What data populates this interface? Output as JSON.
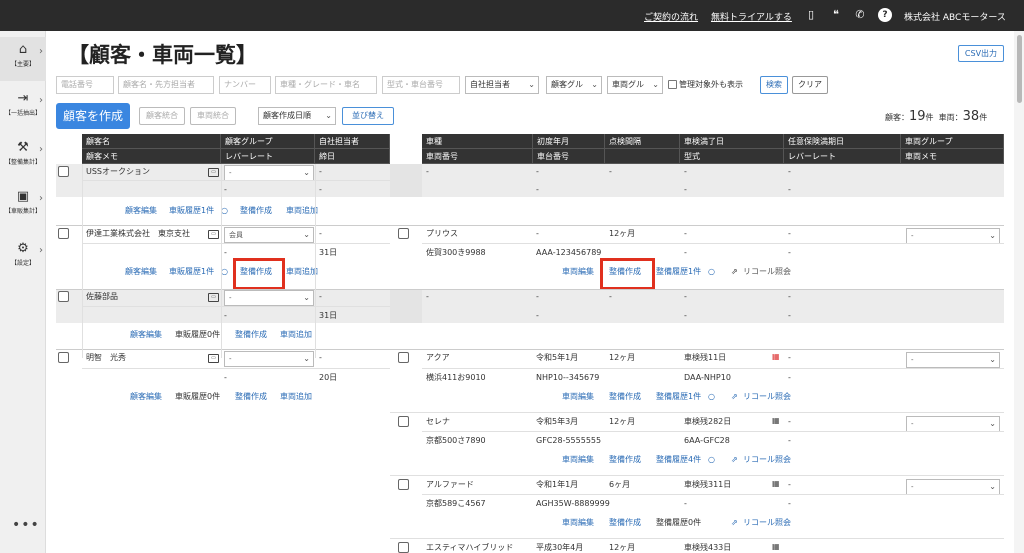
{
  "topbar": {
    "links": [
      "ご契約の流れ",
      "無料トライアルする"
    ],
    "company": "株式会社 ABCモータース",
    "icons": [
      "document-icon",
      "chat-icon",
      "phone-icon",
      "help-icon"
    ]
  },
  "sidebar": {
    "items": [
      {
        "label": "【主要】",
        "icon": "home-icon",
        "glyph": "⌂"
      },
      {
        "label": "【一括抽出】",
        "icon": "extract-icon",
        "glyph": "⇥"
      },
      {
        "label": "【整備集計】",
        "icon": "wrench-icon",
        "glyph": "⚒"
      },
      {
        "label": "【車販集計】",
        "icon": "car-icon",
        "glyph": "▣"
      },
      {
        "label": "【設定】",
        "icon": "gear-icon",
        "glyph": "⚙"
      }
    ],
    "more": "•••"
  },
  "page": {
    "title": "【顧客・車両一覧】",
    "csv_button": "CSV出力"
  },
  "filters": {
    "phone_placeholder": "電話番号",
    "name_placeholder": "顧客名・先方担当者",
    "number_placeholder": "ナンバー",
    "model_placeholder": "車種・グレード・車名",
    "type_placeholder": "型式・車台番号",
    "staff_select": "自社担当者",
    "customer_group_select": "顧客グル",
    "vehicle_group_select": "車両グル",
    "include_unmanaged": "管理対象外も表示",
    "search": "検索",
    "clear": "クリア"
  },
  "actions": {
    "create_customer": "顧客を作成",
    "merge_customers": "顧客統合",
    "merge_vehicles": "車両統合",
    "sort_select": "顧客作成日順",
    "sort_button": "並び替え"
  },
  "counts": {
    "customers_label": "顧客：",
    "customers_value": "19",
    "vehicles_label": "車両：",
    "vehicles_value": "38",
    "unit": "件"
  },
  "customer_headers": {
    "row1": [
      "顧客名",
      "顧客グループ",
      "自社担当者"
    ],
    "row2": [
      "顧客メモ",
      "レバーレート",
      "締日"
    ]
  },
  "vehicle_headers": {
    "row1": [
      "車種",
      "初度年月",
      "点検間隔",
      "車検満了日",
      "任意保険満期日",
      "車両グループ"
    ],
    "row2": [
      "車両番号",
      "車台番号",
      "",
      "型式",
      "レバーレート",
      "車両メモ"
    ]
  },
  "customers": [
    {
      "name": "USSオークション",
      "group": "-",
      "staff": "-",
      "memo": "",
      "rate": "-",
      "closing": "-",
      "actions": [
        "顧客編集",
        "車販履歴1件",
        "整備作成",
        "車両追加"
      ]
    },
    {
      "name": "伊達工業株式会社　東京支社",
      "group": "会員",
      "staff": "-",
      "memo": "",
      "rate": "-",
      "closing": "31日",
      "actions": [
        "顧客編集",
        "車販履歴1件",
        "整備作成",
        "車両追加"
      ]
    },
    {
      "name": "佐藤部品",
      "group": "-",
      "staff": "-",
      "memo": "",
      "rate": "-",
      "closing": "31日",
      "actions": [
        "顧客編集",
        "車販履歴0件",
        "整備作成",
        "車両追加"
      ]
    },
    {
      "name": "明智　光秀",
      "group": "-",
      "staff": "-",
      "memo": "",
      "rate": "-",
      "closing": "20日",
      "actions": [
        "顧客編集",
        "車販履歴0件",
        "整備作成",
        "車両追加"
      ]
    }
  ],
  "empty_vehicle": {
    "dash": "-"
  },
  "vehicles": [
    {
      "model": "プリウス",
      "first_reg": "-",
      "interval": "12ヶ月",
      "inspection": "-",
      "insurance": "-",
      "group": "-",
      "number": "佐賀300き9988",
      "chassis": "AAA-123456789",
      "type": "-",
      "rate": "-",
      "memo": "",
      "actions": [
        "車両編集",
        "整備作成",
        "整備履歴1件",
        "リコール照会"
      ]
    },
    {
      "model": "アクア",
      "first_reg": "令和5年1月",
      "interval": "12ヶ月",
      "inspection": "車検残11日",
      "insurance": "-",
      "group": "-",
      "number": "横浜411お9010",
      "chassis": "NHP10--345679",
      "type": "DAA-NHP10",
      "rate": "-",
      "memo": "",
      "actions": [
        "車両編集",
        "整備作成",
        "整備履歴1件",
        "リコール照会"
      ]
    },
    {
      "model": "セレナ",
      "first_reg": "令和5年3月",
      "interval": "12ヶ月",
      "inspection": "車検残282日",
      "insurance": "-",
      "group": "-",
      "number": "京都500さ7890",
      "chassis": "GFC28-5555555",
      "type": "6AA-GFC28",
      "rate": "-",
      "memo": "",
      "actions": [
        "車両編集",
        "整備作成",
        "整備履歴4件",
        "リコール照会"
      ]
    },
    {
      "model": "アルファード",
      "first_reg": "令和1年1月",
      "interval": "6ヶ月",
      "inspection": "車検残311日",
      "insurance": "-",
      "group": "-",
      "number": "京都589こ4567",
      "chassis": "AGH35W-8889999",
      "type": "-",
      "rate": "-",
      "memo": "",
      "actions": [
        "車両編集",
        "整備作成",
        "整備履歴0件",
        "リコール照会"
      ]
    },
    {
      "model": "エスティマハイブリッド",
      "first_reg": "平成30年4月",
      "interval": "12ヶ月",
      "inspection": "車検残433日",
      "insurance": "",
      "group": "",
      "number": "",
      "chassis": "",
      "type": "",
      "rate": "",
      "memo": "",
      "actions": []
    }
  ],
  "colors": {
    "highlight": "#e0301e",
    "accent": "#3a86e0",
    "header": "#333333"
  }
}
